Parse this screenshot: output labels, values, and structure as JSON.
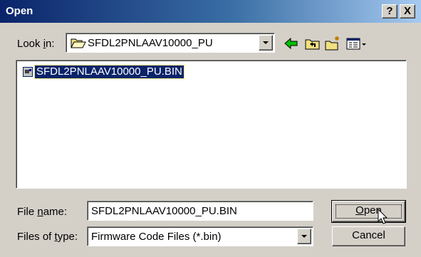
{
  "window": {
    "title": "Open",
    "help_button": "?",
    "close_button": "X"
  },
  "look_in": {
    "label_before": "Look ",
    "label_mnemonic": "i",
    "label_after": "n:",
    "value": "SFDL2PNLAAV10000_PU"
  },
  "toolbar": {
    "back_icon": "back-arrow-icon",
    "up_icon": "up-one-level-icon",
    "new_folder_icon": "new-folder-icon",
    "view_icon": "view-menu-icon"
  },
  "files": [
    {
      "name": "SFDL2PNLAAV10000_PU.BIN",
      "icon": "bin-file-icon",
      "selected": true
    }
  ],
  "file_name": {
    "label_before": "File ",
    "label_mnemonic": "n",
    "label_after": "ame:",
    "value": "SFDL2PNLAAV10000_PU.BIN"
  },
  "file_type": {
    "label_before": "Files of ",
    "label_mnemonic": "t",
    "label_after": "ype:",
    "value": "Firmware Code Files (*.bin)"
  },
  "buttons": {
    "open_mnemonic": "O",
    "open_rest": "pen",
    "cancel": "Cancel"
  },
  "colors": {
    "title_gradient_start": "#0a246a",
    "title_gradient_end": "#a6caf0",
    "selection": "#0a246a",
    "face": "#d4d0c8"
  }
}
